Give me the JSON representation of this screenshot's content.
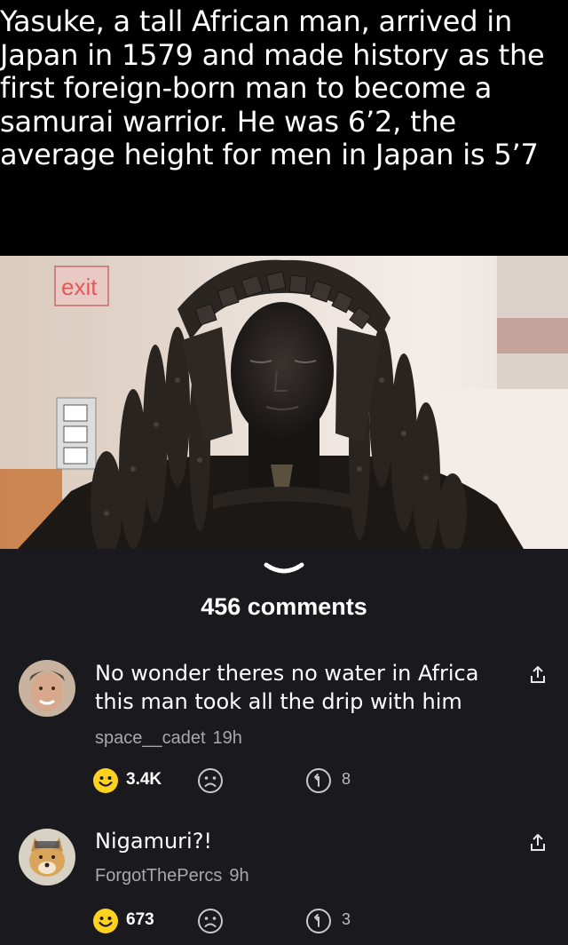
{
  "post": {
    "caption": "Yasuke, a tall African man, arrived in\nJapan in 1579 and made history as the\nfirst foreign-born man to become a\nsamurai warrior. He was 6’2, the\naverage height for men in Japan is 5’7",
    "image_sign_text": "exit"
  },
  "comments_header": {
    "label": "456 comments"
  },
  "comments": [
    {
      "text": "No wonder theres no water in Africa this man took all the drip with him",
      "username": "space__cadet",
      "time": "19h",
      "upvotes": "3.4K",
      "replies": "8"
    },
    {
      "text": "Nigamuri?!",
      "username": "ForgotThePercs",
      "time": "9h",
      "upvotes": "673",
      "replies": "3"
    }
  ],
  "colors": {
    "background": "#1a1a1e",
    "caption_bg": "#000000",
    "smile": "#ffd21f",
    "muted_text": "#a8a8ad"
  },
  "icons": [
    "chevron-down-icon",
    "share-icon",
    "smile-upvote-icon",
    "frown-downvote-icon",
    "reply-icon"
  ]
}
